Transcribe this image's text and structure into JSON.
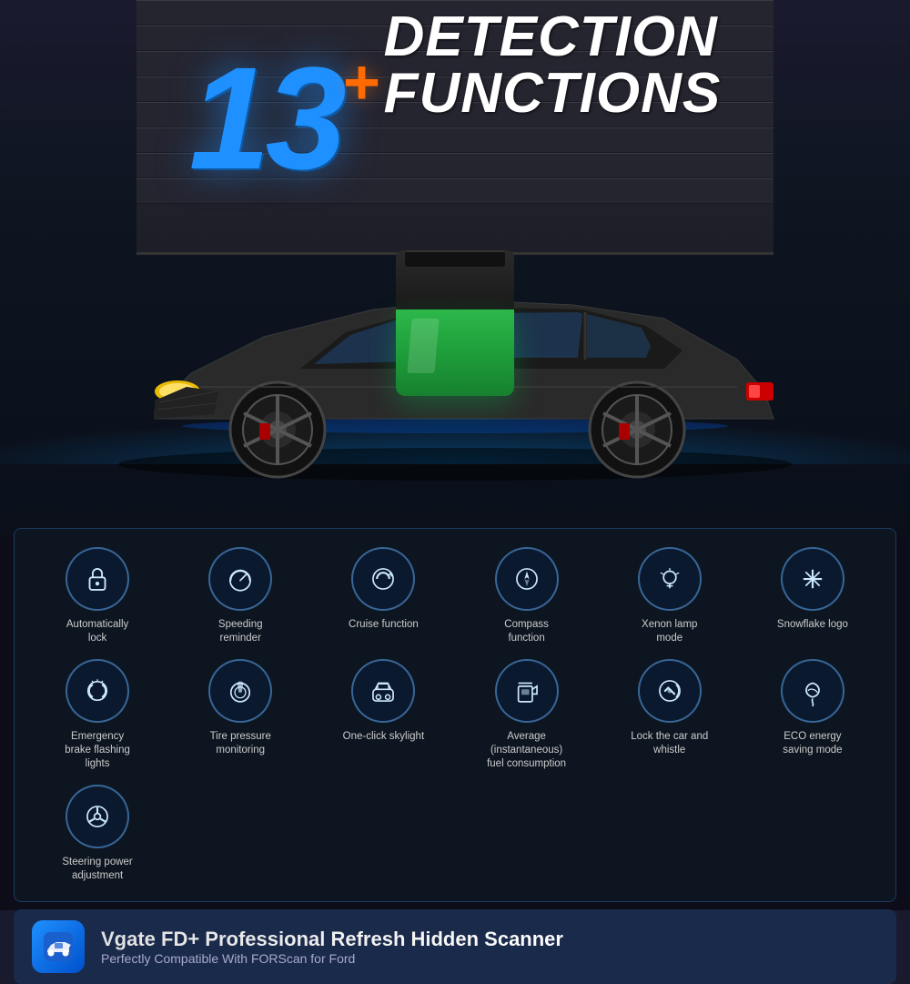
{
  "hero": {
    "number": "13",
    "plus": "+",
    "line1": "DETECTION",
    "line2": "FUNCTIONS"
  },
  "features": [
    {
      "id": "auto-lock",
      "icon": "🔒",
      "label": "Automatically lock"
    },
    {
      "id": "speeding-reminder",
      "icon": "🕐",
      "label": "Speeding reminder"
    },
    {
      "id": "cruise-function",
      "icon": "↻",
      "label": "Cruise function"
    },
    {
      "id": "compass-function",
      "icon": "🧭",
      "label": "Compass function"
    },
    {
      "id": "xenon-lamp",
      "icon": "💡",
      "label": "Xenon lamp mode"
    },
    {
      "id": "snowflake-logo",
      "icon": "❄",
      "label": "Snowflake logo"
    },
    {
      "id": "emergency-brake",
      "icon": "🔦",
      "label": "Emergency brake flashing lights"
    },
    {
      "id": "tire-pressure",
      "icon": "🌀",
      "label": "Tire pressure monitoring"
    },
    {
      "id": "one-click-skylight",
      "icon": "🚗",
      "label": "One-click skylight"
    },
    {
      "id": "fuel-consumption",
      "icon": "⛽",
      "label": "Average (instantaneous) fuel consumption"
    },
    {
      "id": "lock-whistle",
      "icon": "🔧",
      "label": "Lock the car and whistle"
    },
    {
      "id": "eco-energy",
      "icon": "♻",
      "label": "ECO energy saving mode"
    },
    {
      "id": "steering-power",
      "icon": "⚙",
      "label": "Steering power adjustment"
    }
  ],
  "banner": {
    "app_icon": "🚗",
    "title": "Vgate FD+ Professional Refresh Hidden Scanner",
    "subtitle": "Perfectly Compatible With FORScan for Ford"
  }
}
